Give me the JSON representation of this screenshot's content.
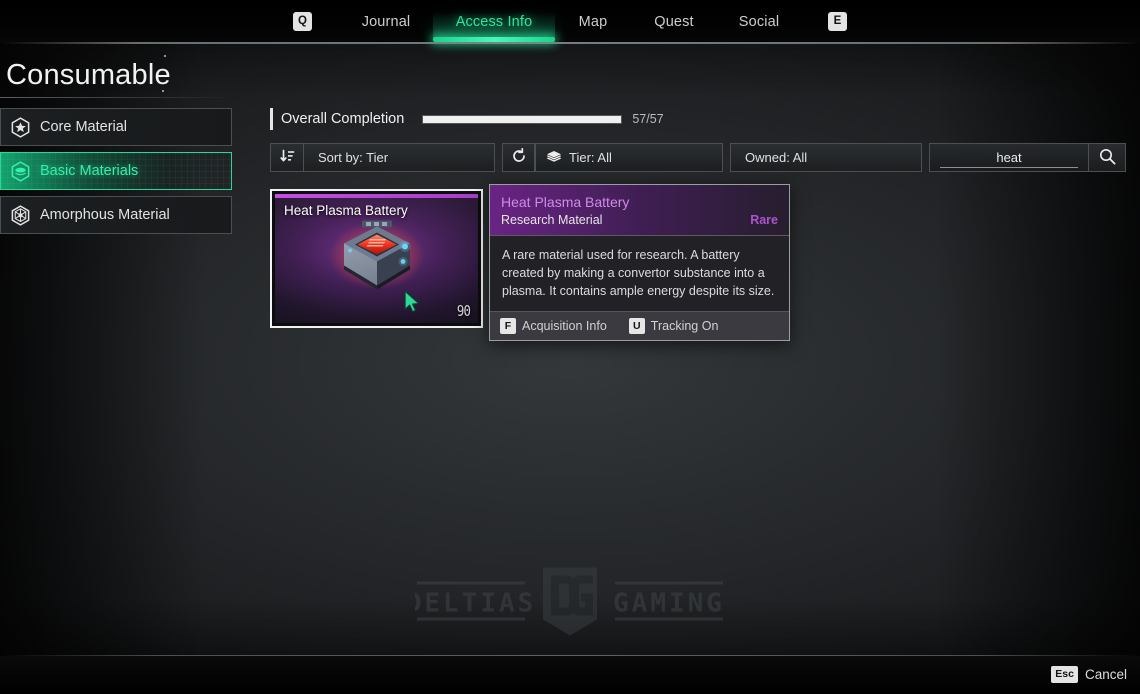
{
  "topnav": {
    "left_key": "Q",
    "right_key": "E",
    "tabs": [
      {
        "label": "Journal",
        "active": false
      },
      {
        "label": "Access Info",
        "active": true
      },
      {
        "label": "Map",
        "active": false
      },
      {
        "label": "Quest",
        "active": false
      },
      {
        "label": "Social",
        "active": false
      }
    ]
  },
  "page": {
    "title": "Consumable"
  },
  "sidebar": {
    "items": [
      {
        "label": "Core Material",
        "icon": "hex-star-icon",
        "active": false
      },
      {
        "label": "Basic Materials",
        "icon": "hex-layers-icon",
        "active": true
      },
      {
        "label": "Amorphous Material",
        "icon": "hex-web-icon",
        "active": false
      }
    ]
  },
  "completion": {
    "label": "Overall Completion",
    "count": "57/57",
    "current": 57,
    "total": 57,
    "percent": 100
  },
  "filters": {
    "sort_icon": "sort-descending-icon",
    "sort_label": "Sort by: Tier",
    "reset_icon": "refresh-icon",
    "tier_icon": "layers-icon",
    "tier_label": "Tier: All",
    "owned_label": "Owned: All",
    "search_value": "heat",
    "search_placeholder": "Search",
    "search_icon": "search-icon"
  },
  "item_card": {
    "name": "Heat Plasma Battery",
    "count": "90",
    "rarity_color": "#c44ee0",
    "selected": true,
    "cursor_icon": "cursor-arrow-icon"
  },
  "tooltip": {
    "title": "Heat Plasma Battery",
    "subtitle": "Research Material",
    "rarity": "Rare",
    "rarity_color": "#ab55cb",
    "description": "A rare material used for research. A battery created by making a convertor substance into a plasma. It contains ample energy despite its size.",
    "actions": [
      {
        "key": "F",
        "label": "Acquisition Info"
      },
      {
        "key": "U",
        "label": "Tracking On"
      }
    ]
  },
  "watermark": {
    "left_text": "DELTIAS",
    "right_text": "GAMING",
    "monogram": "DG"
  },
  "bottombar": {
    "cancel_key": "Esc",
    "cancel_label": "Cancel"
  }
}
